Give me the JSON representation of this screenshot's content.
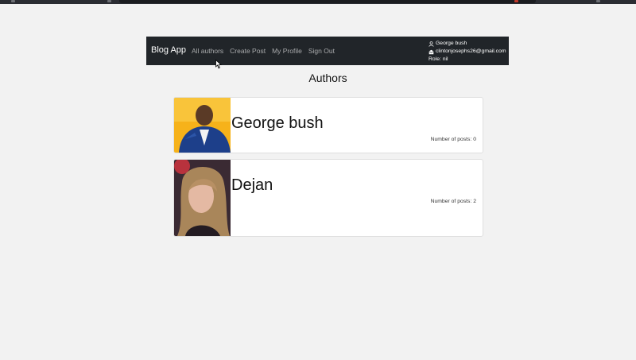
{
  "navbar": {
    "brand": "Blog App",
    "links": [
      "All authors",
      "Create Post",
      "My Profile",
      "Sign Out"
    ],
    "user": {
      "name": "George bush",
      "email": "clintonjosephs26@gmail.com",
      "role": "Role: nil"
    }
  },
  "main": {
    "title": "Authors",
    "authors": [
      {
        "name": "George bush",
        "posts": "Number of posts: 0"
      },
      {
        "name": "Dejan",
        "posts": "Number of posts: 2"
      }
    ]
  },
  "colors": {
    "navbar_bg": "#212529",
    "page_bg": "#f2f2f2",
    "card_bg": "#ffffff",
    "avatar1_bg": "#f6b21a",
    "avatar2_bg": "#3a2a33"
  },
  "icons": [
    "user-icon",
    "envelope-icon",
    "mouse-pointer-icon"
  ]
}
